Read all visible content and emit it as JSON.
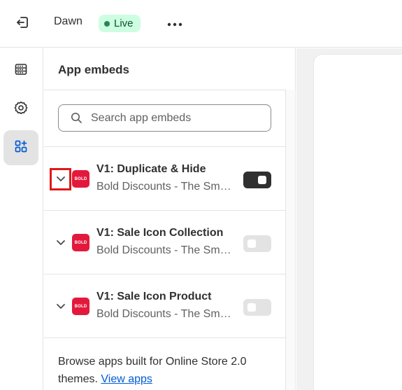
{
  "topbar": {
    "exit_icon": "exit-icon",
    "theme_name": "Dawn",
    "status_badge": "Live",
    "more_icon": "more-horizontal-icon"
  },
  "rail": {
    "items": [
      {
        "icon": "sections-icon",
        "active": false
      },
      {
        "icon": "settings-gear-icon",
        "active": false
      },
      {
        "icon": "app-embeds-icon",
        "active": true
      }
    ]
  },
  "panel": {
    "title": "App embeds",
    "search": {
      "placeholder": "Search app embeds",
      "value": ""
    },
    "embeds": [
      {
        "title": "V1: Duplicate & Hide",
        "subtitle": "Bold Discounts - The Smart Discounts App",
        "logo_text": "BOLD",
        "enabled": true
      },
      {
        "title": "V1: Sale Icon Collection",
        "subtitle": "Bold Discounts - The Smart Discounts App",
        "logo_text": "BOLD",
        "enabled": false
      },
      {
        "title": "V1: Sale Icon Product",
        "subtitle": "Bold Discounts - The Smart Discounts App",
        "logo_text": "BOLD",
        "enabled": false
      }
    ],
    "footer": {
      "text": "Browse apps built for Online Store 2.0 themes.",
      "link": "View apps"
    }
  },
  "colors": {
    "live_badge_bg": "#cdfee1",
    "live_dot": "#29845a",
    "toggle_on": "#303030",
    "toggle_off": "#e3e3e3",
    "app_logo": "#e3193c",
    "link": "#005bd3",
    "highlight": "#e01818"
  }
}
